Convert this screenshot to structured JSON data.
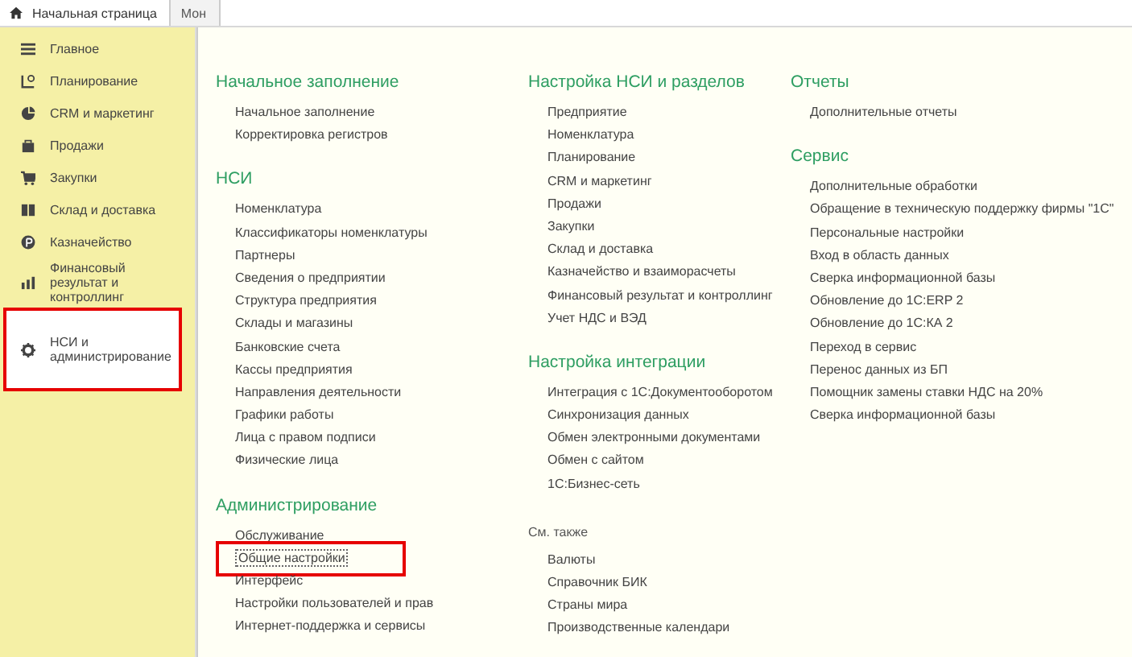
{
  "tabs": [
    {
      "label": "Начальная страница",
      "selected": true
    },
    {
      "label": "Мон",
      "selected": false
    }
  ],
  "sidebar": {
    "items": [
      {
        "label": "Главное",
        "selected": false,
        "highlighted": false
      },
      {
        "label": "Планирование",
        "selected": false,
        "highlighted": false
      },
      {
        "label": "CRM и маркетинг",
        "selected": false,
        "highlighted": false
      },
      {
        "label": "Продажи",
        "selected": false,
        "highlighted": false
      },
      {
        "label": "Закупки",
        "selected": false,
        "highlighted": false
      },
      {
        "label": "Склад и доставка",
        "selected": false,
        "highlighted": false
      },
      {
        "label": "Казначейство",
        "selected": false,
        "highlighted": false
      },
      {
        "label": "Финансовый результат и контроллинг",
        "selected": false,
        "highlighted": false
      },
      {
        "label": "НСИ и администрирование",
        "selected": true,
        "highlighted": true
      }
    ]
  },
  "columns": [
    {
      "groups": [
        {
          "title": "Начальное заполнение",
          "kind": "section",
          "items": [
            {
              "label": "Начальное заполнение",
              "highlighted": false
            },
            {
              "label": "Корректировка регистров",
              "highlighted": false
            }
          ]
        },
        {
          "title": "НСИ",
          "kind": "section",
          "items": [
            {
              "label": "Номенклатура",
              "highlighted": false
            },
            {
              "label": "Классификаторы номенклатуры",
              "highlighted": false
            },
            {
              "label": "Партнеры",
              "highlighted": false
            },
            {
              "label": "Сведения о предприятии",
              "highlighted": false
            },
            {
              "label": "Структура предприятия",
              "highlighted": false
            },
            {
              "label": "Склады и магазины",
              "highlighted": false
            },
            {
              "label": "Банковские счета",
              "highlighted": false
            },
            {
              "label": "Кассы предприятия",
              "highlighted": false
            },
            {
              "label": "Направления деятельности",
              "highlighted": false
            },
            {
              "label": "Графики работы",
              "highlighted": false
            },
            {
              "label": "Лица с правом подписи",
              "highlighted": false
            },
            {
              "label": "Физические лица",
              "highlighted": false
            }
          ]
        },
        {
          "title": "Администрирование",
          "kind": "section",
          "items": [
            {
              "label": "Обслуживание",
              "highlighted": false
            },
            {
              "label": "Общие настройки",
              "highlighted": true
            },
            {
              "label": "Интерфейс",
              "highlighted": false
            },
            {
              "label": "Настройки пользователей и прав",
              "highlighted": false
            },
            {
              "label": "Интернет-поддержка и сервисы",
              "highlighted": false
            }
          ]
        }
      ]
    },
    {
      "groups": [
        {
          "title": "Настройка НСИ и разделов",
          "kind": "section",
          "items": [
            {
              "label": "Предприятие",
              "highlighted": false
            },
            {
              "label": "Номенклатура",
              "highlighted": false
            },
            {
              "label": "Планирование",
              "highlighted": false
            },
            {
              "label": "CRM и маркетинг",
              "highlighted": false
            },
            {
              "label": "Продажи",
              "highlighted": false
            },
            {
              "label": "Закупки",
              "highlighted": false
            },
            {
              "label": "Склад и доставка",
              "highlighted": false
            },
            {
              "label": "Казначейство и взаиморасчеты",
              "highlighted": false
            },
            {
              "label": "Финансовый результат и контроллинг",
              "highlighted": false
            },
            {
              "label": "Учет НДС и ВЭД",
              "highlighted": false
            }
          ]
        },
        {
          "title": "Настройка интеграции",
          "kind": "section",
          "items": [
            {
              "label": "Интеграция с 1С:Документооборотом",
              "highlighted": false
            },
            {
              "label": "Синхронизация данных",
              "highlighted": false
            },
            {
              "label": "Обмен электронными документами",
              "highlighted": false
            },
            {
              "label": "Обмен с сайтом",
              "highlighted": false
            },
            {
              "label": "1С:Бизнес-сеть",
              "highlighted": false
            }
          ]
        },
        {
          "title": "См. также",
          "kind": "see-also",
          "items": [
            {
              "label": "Валюты",
              "highlighted": false
            },
            {
              "label": "Справочник БИК",
              "highlighted": false
            },
            {
              "label": "Страны мира",
              "highlighted": false
            },
            {
              "label": "Производственные календари",
              "highlighted": false
            }
          ]
        }
      ]
    },
    {
      "groups": [
        {
          "title": "Отчеты",
          "kind": "section",
          "items": [
            {
              "label": "Дополнительные отчеты",
              "highlighted": false
            }
          ]
        },
        {
          "title": "Сервис",
          "kind": "section",
          "items": [
            {
              "label": "Дополнительные обработки",
              "highlighted": false
            },
            {
              "label": "Обращение в техническую поддержку фирмы \"1С\"",
              "highlighted": false
            },
            {
              "label": "Персональные настройки",
              "highlighted": false
            },
            {
              "label": "Вход в область данных",
              "highlighted": false
            },
            {
              "label": "Сверка информационной базы",
              "highlighted": false
            },
            {
              "label": "Обновление до 1С:ERP 2",
              "highlighted": false
            },
            {
              "label": "Обновление до 1С:КА 2",
              "highlighted": false
            },
            {
              "label": "Переход в сервис",
              "highlighted": false
            },
            {
              "label": "Перенос данных из БП",
              "highlighted": false
            },
            {
              "label": "Помощник замены ставки НДС на 20%",
              "highlighted": false
            },
            {
              "label": "Сверка информационной базы",
              "highlighted": false
            }
          ]
        }
      ]
    }
  ]
}
